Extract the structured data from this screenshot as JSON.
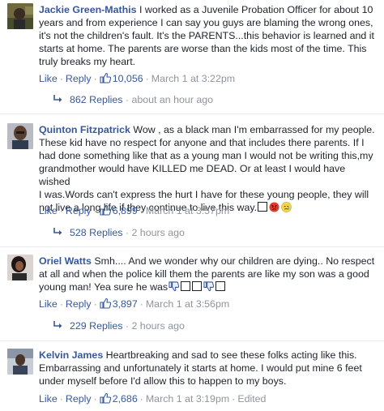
{
  "comments": [
    {
      "author": "Jackie Green-Mathis",
      "text": "I worked as a Juvenile Probation Officer for about 10 years and from experience I can say you guys are blaming the wrong ones, it's not the children's fault. It's the PARENTS...this behavior is learned and it starts at home. The parents are worse than the kids most of the time. This truly breaks my heart.",
      "like_label": "Like",
      "reply_label": "Reply",
      "likes": "10,056",
      "time": "March 1 at 3:22pm",
      "replies_label": "862 Replies",
      "replies_time": "about an hour ago"
    },
    {
      "author": "Quinton Fitzpatrick",
      "text_lines": [
        "Wow , as a black man I'm embarrassed for my people.",
        "These kid have no respect for anyone and that includes there parents. If I",
        "had done something like that as a young man I would not be writing this,my",
        "grandmother would have KILLED me DEAD. Or at least I would have wished",
        "I was.Words can't express the hurt I have for these young people, they will",
        "not live a long life if they continue to live this way."
      ],
      "like_label": "Like",
      "reply_label": "Reply",
      "likes": "6,899",
      "time": "March 1 at 3:57pm",
      "replies_label": "528 Replies",
      "replies_time": "2 hours ago"
    },
    {
      "author": "Oriel Watts",
      "text_lines": [
        "Smh.... And we wonder why our children are dying.. No respect",
        "at all and when the police kill them the parents are like my son was a good",
        "young man! Yea sure he was"
      ],
      "like_label": "Like",
      "reply_label": "Reply",
      "likes": "3,897",
      "time": "March 1 at 3:56pm",
      "replies_label": "229 Replies",
      "replies_time": "2 hours ago"
    },
    {
      "author": "Kelvin James",
      "text": "Heartbreaking and sad to see these folks acting like this. Embarrassing and unfortunately it starts at home. I would put mine 6 feet under myself before I'd allow this to happen to my boys.",
      "like_label": "Like",
      "reply_label": "Reply",
      "likes": "2,686",
      "time": "March 1 at 3:19pm",
      "edited": "Edited"
    }
  ],
  "colors": {
    "link": "#365899",
    "meta": "#90949c",
    "text": "#1d2129"
  },
  "icons": {
    "like": "thumbs-up-icon",
    "reply_arrow": "reply-arrow-icon",
    "emoji_angry": "angry-face-icon",
    "emoji_sad": "sad-face-icon",
    "thumbs_down": "thumbs-down-icon",
    "missing_glyph": "missing-glyph-box"
  }
}
